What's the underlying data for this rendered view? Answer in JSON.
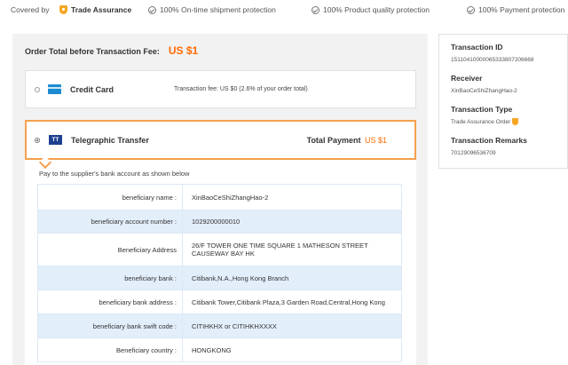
{
  "topbar": {
    "covered_by": "Covered by",
    "trade_assurance": "Trade Assurance",
    "protections": [
      "100% On-time shipment protection",
      "100% Product quality protection",
      "100% Payment protection"
    ]
  },
  "order": {
    "total_label": "Order Total before Transaction Fee:",
    "total_value": "US $1"
  },
  "credit_card": {
    "label": "Credit Card",
    "fee_text": "Transaction fee: US $0 (2.6% of your order total)"
  },
  "telegraphic": {
    "icon_text": "TT",
    "label": "Telegraphic Transfer",
    "total_payment_label": "Total Payment",
    "total_payment_value": "US $1",
    "pay_note": "Pay to the supplier's bank account as shown below",
    "bank_rows": [
      {
        "key": "beneficiary name :",
        "value": "XinBaoCeShiZhangHao-2"
      },
      {
        "key": "beneficiary account number :",
        "value": "1029200000010"
      },
      {
        "key": "Beneficiary Address",
        "value": "26/F TOWER ONE TIME SQUARE 1 MATHESON STREET CAUSEWAY BAY HK"
      },
      {
        "key": "beneficiary bank :",
        "value": "Citibank,N.A.,Hong Kong Branch"
      },
      {
        "key": "beneficiary bank address :",
        "value": "Citibank Tower,Citibank Plaza,3 Garden Road,Central,Hong Kong"
      },
      {
        "key": "beneficiary bank swift code :",
        "value": "CITIHKHX or CITIHKHXXXX"
      },
      {
        "key": "Beneficiary country :",
        "value": "HONGKONG"
      }
    ]
  },
  "transaction": {
    "id_label": "Transaction ID",
    "id_value": "15110410000065333807206668",
    "receiver_label": "Receiver",
    "receiver_value": "XinBaoCeShiZhangHao-2",
    "type_label": "Transaction Type",
    "type_value": "Trade Assurance Order",
    "remarks_label": "Transaction Remarks",
    "remarks_value": "70129096536709"
  },
  "colors": {
    "accent": "#ff6a00",
    "selected_border": "#f5a04f",
    "table_alt_row": "#e3eefb",
    "tt_icon": "#1f3f8f",
    "cc_icon": "#1d8bd1"
  }
}
